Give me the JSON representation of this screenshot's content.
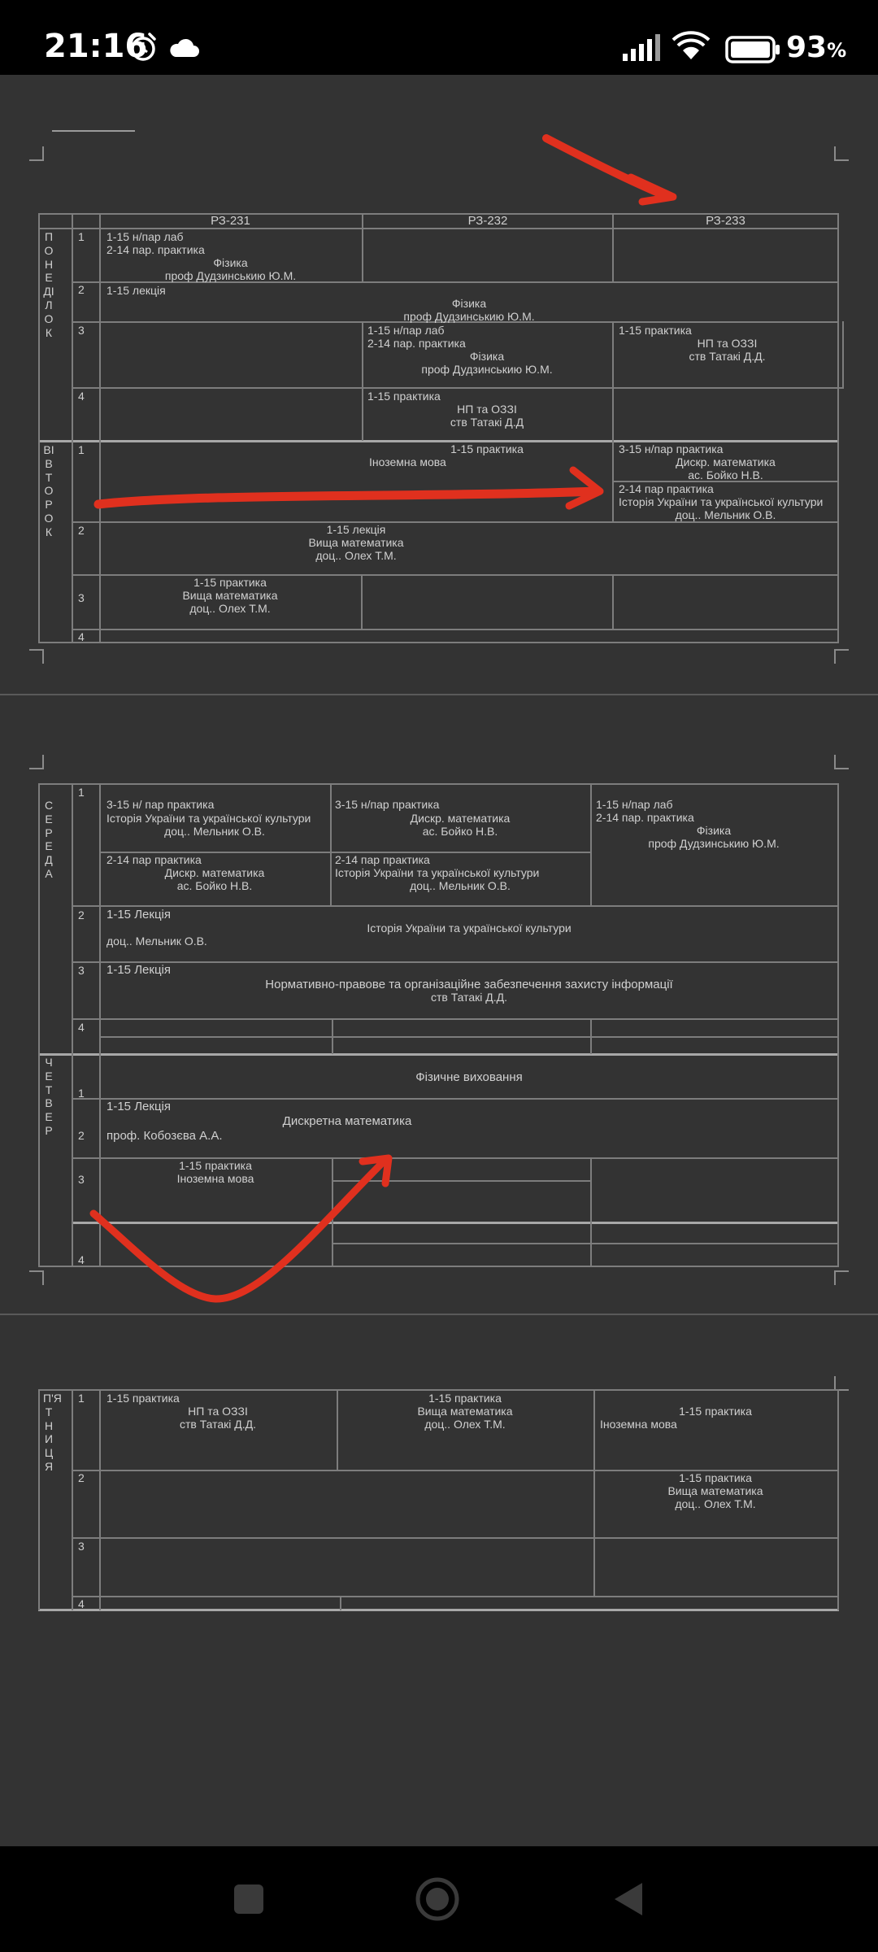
{
  "status_bar": {
    "time": "21:16",
    "battery": "93",
    "battery_unit": "%"
  },
  "headers": {
    "g1": "РЗ-231",
    "g2": "РЗ-232",
    "g3": "РЗ-233"
  },
  "days": {
    "mon": "ПОНЕДІЛОК",
    "tue": "ВІВТОРОК",
    "wed": "СЕРЕДА",
    "thu": "ЧЕТВЕР",
    "fri": "П'ЯТНИЦЯ"
  },
  "nums": {
    "n1": "1",
    "n2": "2",
    "n3": "3",
    "n4": "4"
  },
  "monday": {
    "p1_g1_l1": "1-15 н/пар лаб",
    "p1_g1_l2": "2-14 пар. практика",
    "p1_g1_l3": "Фізика",
    "p1_g1_l4": "проф Дудзинськию Ю.М.",
    "p2_l1": "1-15 лекція",
    "p2_l2": "Фізика",
    "p2_l3": "проф Дудзинськию Ю.М.",
    "p3_g2_l1": "1-15 н/пар лаб",
    "p3_g2_l2": "2-14 пар. практика",
    "p3_g2_l3": "Фізика",
    "p3_g2_l4": "проф Дудзинськию Ю.М.",
    "p3_g3_l1": "1-15 практика",
    "p3_g3_l2": "НП та ОЗЗІ",
    "p3_g3_l3": "ств Татакі Д.Д.",
    "p4_g2_l1": "1-15 практика",
    "p4_g2_l2": "НП та ОЗЗІ",
    "p4_g2_l3": "ств Татакі Д.Д"
  },
  "tuesday": {
    "p1_g2_l1": "1-15  практика",
    "p1_g2_l2": "Іноземна мова",
    "p1_g3a_l1": "3-15 н/пар практика",
    "p1_g3a_l2": "Дискр. математика",
    "p1_g3a_l3": "ас. Бойко Н.В.",
    "p1_g3b_l1": "2-14 пар практика",
    "p1_g3b_l2": "Історія України та української культури",
    "p1_g3b_l3": "доц.. Мельник О.В.",
    "p2_l1": "1-15 лекція",
    "p2_l2": "Вища математика",
    "p2_l3": "доц.. Олех Т.М.",
    "p3_g1_l1": "1-15 практика",
    "p3_g1_l2": "Вища математика",
    "p3_g1_l3": "доц.. Олех Т.М."
  },
  "wednesday": {
    "p1_g1a_l1": "3-15 н/ пар практика",
    "p1_g1a_l2": "Історія України та української культури",
    "p1_g1a_l3": "доц.. Мельник О.В.",
    "p1_g1b_l1": "2-14 пар практика",
    "p1_g1b_l2": "Дискр. математика",
    "p1_g1b_l3": "ас. Бойко Н.В.",
    "p1_g2a_l1": "3-15 н/пар практика",
    "p1_g2a_l2": "Дискр. математика",
    "p1_g2a_l3": "ас. Бойко Н.В.",
    "p1_g2b_l1": "2-14 пар практика",
    "p1_g2b_l2": "Історія України та української культури",
    "p1_g2b_l3": "доц.. Мельник О.В.",
    "p1_g3_l1": "1-15 н/пар лаб",
    "p1_g3_l2": "2-14 пар. практика",
    "p1_g3_l3": "Фізика",
    "p1_g3_l4": "проф Дудзинськию Ю.М.",
    "p2_l1": "1-15 Лекція",
    "p2_l2": "Історія України та української культури",
    "p2_l3": "доц.. Мельник О.В.",
    "p3_l1": "1-15 Лекція",
    "p3_l2": "Нормативно-правове та організаційне забезпечення захисту інформації",
    "p3_l3": "ств Татакі Д.Д."
  },
  "thursday": {
    "p1_l1": "Фізичне виховання",
    "p2_l1": "1-15 Лекція",
    "p2_l2": "Дискретна математика",
    "p2_l3": "проф. Кобозєва А.А.",
    "p3_g1_l1": "1-15 практика",
    "p3_g1_l2": "Іноземна мова"
  },
  "friday": {
    "p1_g1_l1": "1-15 практика",
    "p1_g1_l2": "НП та ОЗЗІ",
    "p1_g1_l3": "ств Татакі Д.Д.",
    "p1_g2_l1": "1-15 практика",
    "p1_g2_l2": "Вища математика",
    "p1_g2_l3": "доц.. Олех Т.М.",
    "p1_g3_l1": "1-15 практика",
    "p1_g3_l2": "Іноземна мова",
    "p2_g3_l1": "1-15 практика",
    "p2_g3_l2": "Вища математика",
    "p2_g3_l3": "доц.. Олех Т.М."
  },
  "colors": {
    "annotation": "#e0301e",
    "page_bg": "#333333",
    "grid": "#7d7d7d"
  },
  "icons": [
    "alarm-icon",
    "cloud-icon",
    "signal-icon",
    "wifi-icon",
    "battery-icon",
    "recent-apps-icon",
    "home-icon",
    "back-icon"
  ]
}
